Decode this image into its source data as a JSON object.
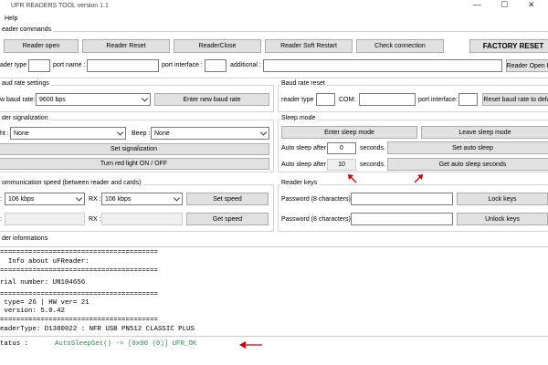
{
  "window": {
    "title": "UFR READERS TOOL version 1.1",
    "min_glyph": "—",
    "max_glyph": "☐",
    "close_glyph": "✕"
  },
  "menu": {
    "help": "Help"
  },
  "reader_commands": {
    "title": "eader commands",
    "reader_open": "Reader open",
    "reader_reset": "Reader Reset",
    "reader_close": "ReaderClose",
    "reader_soft_restart": "Reader Soft Restart",
    "check_connection": "Check connection",
    "factory_reset": "FACTORY RESET",
    "reader_type_label": "ader type :",
    "port_name_label": "port name :",
    "port_interface_label": "port interface :",
    "additional_label": "additional :",
    "reader_open_ex": "Reader Open E",
    "reader_type_value": "",
    "port_name_value": "",
    "port_interface_value": "",
    "additional_value": ""
  },
  "baud_settings": {
    "title": "aud rate settings",
    "new_baud_label": "w baud rate:",
    "new_baud_value": "9600 bps",
    "enter_button": "Enter new baud rate"
  },
  "baud_reset": {
    "title": "Baud rate reset",
    "reader_type_label": "reader type",
    "com_label": "COM:",
    "port_interface_label": "port interface:",
    "reset_button": "Reset baud rate to defa"
  },
  "signalization": {
    "title": "der signalization",
    "light_label": "ht :",
    "light_value": "None",
    "beep_label": "Beep :",
    "beep_value": "None",
    "set_button": "Set signalization",
    "red_light_button": "Turn red light ON / OFF"
  },
  "sleep": {
    "title": "Sleep mode",
    "enter_button": "Enter sleep mode",
    "leave_button": "Leave sleep mode",
    "auto_after_label": "Auto sleep after",
    "auto_after_value": "0",
    "seconds1": "seconds.",
    "set_auto_button": "Set auto sleep",
    "auto_after_label2": "Auto sleep after",
    "auto_after_value2": "10",
    "seconds2": "seconds.",
    "get_auto_button": "Get auto sleep seconds"
  },
  "comm_speed": {
    "title": "ommunication speed (between reader and cards)",
    "tx_label": ":",
    "tx_value": "106 kbps",
    "rx_label": "RX :",
    "rx_value": "106 kbps",
    "set_button": "Set speed",
    "tx_label2": ":",
    "rx_label2": "RX :",
    "get_button": "Get speed"
  },
  "reader_keys": {
    "title": "Reader keys",
    "password_label1": "Password (8 characters) :",
    "lock_button": "Lock keys",
    "password_label2": "Password (8 characters) :",
    "unlock_button": "Unlock keys"
  },
  "reader_info": {
    "title": "der informations",
    "lines": [
      "=======================================",
      "  Info about uFReader:",
      "=======================================",
      "rial number: UN104656",
      "=======================================",
      " type= 26 | HW ver= 21",
      " version: 5.0.42",
      "=======================================",
      "eaderType: D1380022 : NFR USB PN512 CLASSIC PLUS"
    ]
  },
  "status": {
    "label": "tatus :",
    "value": "AutoSleepGet() -> [0x00 (0)] UFR_OK"
  },
  "colors": {
    "arrow": "#cc0000",
    "status_green": "#2e8b57",
    "button_bg": "#e1e1e1"
  }
}
